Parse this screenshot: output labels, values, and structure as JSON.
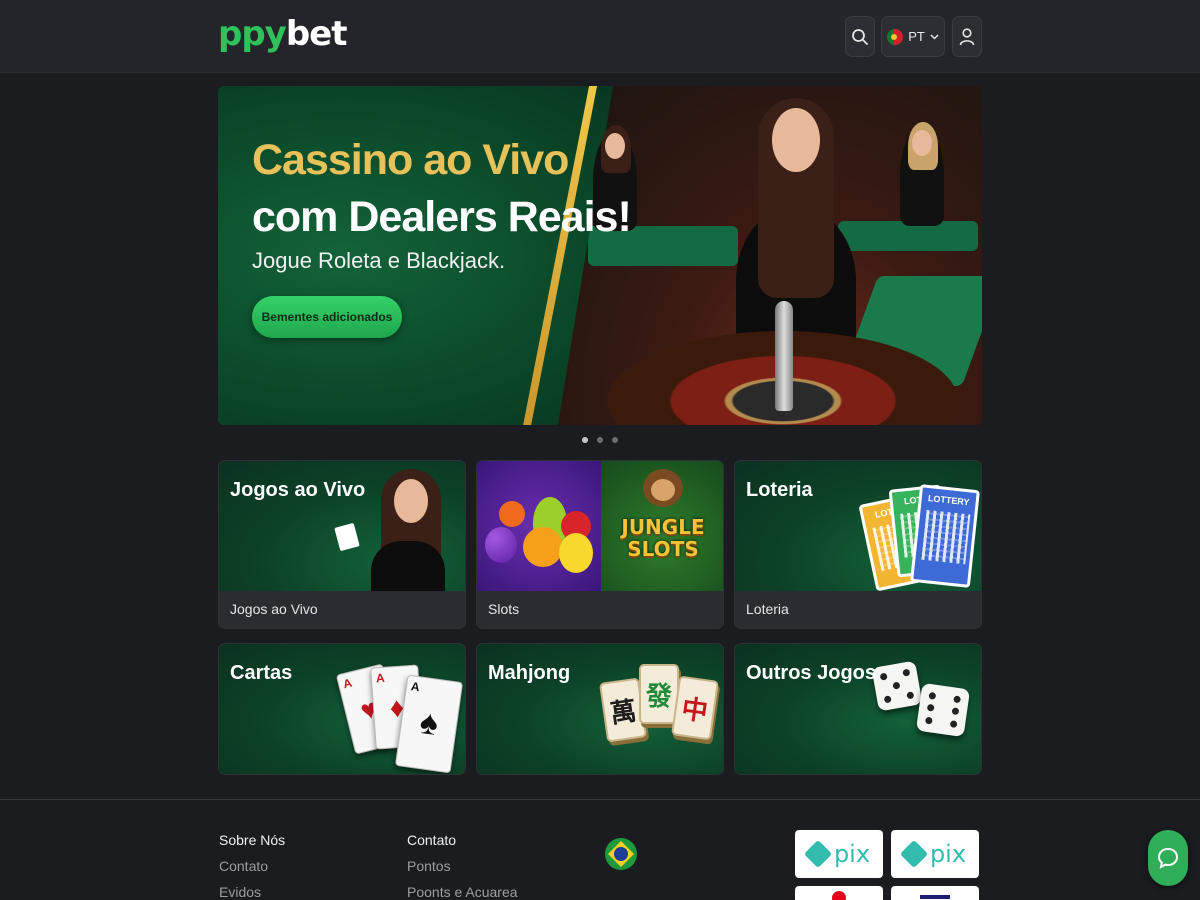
{
  "header": {
    "logo_part1": "ppy",
    "logo_part2": "bet",
    "language": "PT"
  },
  "hero": {
    "title_line1": "Cassino ao Vivo",
    "title_line2": "com Dealers Reais!",
    "subtitle": "Jogue Roleta e Blackjack.",
    "cta": "Bementes adicionados",
    "active_slide": 1,
    "slide_count": 3
  },
  "categories": [
    {
      "title": "Jogos ao Vivo",
      "footer": "Jogos ao Vivo"
    },
    {
      "title": "",
      "footer": "Slots",
      "art_text": "JUNGLE SLOTS"
    },
    {
      "title": "Loteria",
      "footer": "Loteria",
      "ticket_label": "LOTTERY",
      "ticket_label_short": "LOTT"
    },
    {
      "title": "Cartas"
    },
    {
      "title": "Mahjong",
      "tiles": [
        "萬",
        "發",
        "中"
      ]
    },
    {
      "title": "Outros Jogos"
    }
  ],
  "footer": {
    "col1": {
      "heading": "Sobre Nós",
      "links": [
        "Contato",
        "Evidos"
      ]
    },
    "col2": {
      "heading": "Contato",
      "links": [
        "Pontos",
        "Poonts e Acuarea"
      ]
    },
    "payments": [
      "pix",
      "pix"
    ]
  },
  "colors": {
    "brand_green": "#2fc25b",
    "hero_gold": "#e7c25a",
    "background": "#1b1c20"
  }
}
